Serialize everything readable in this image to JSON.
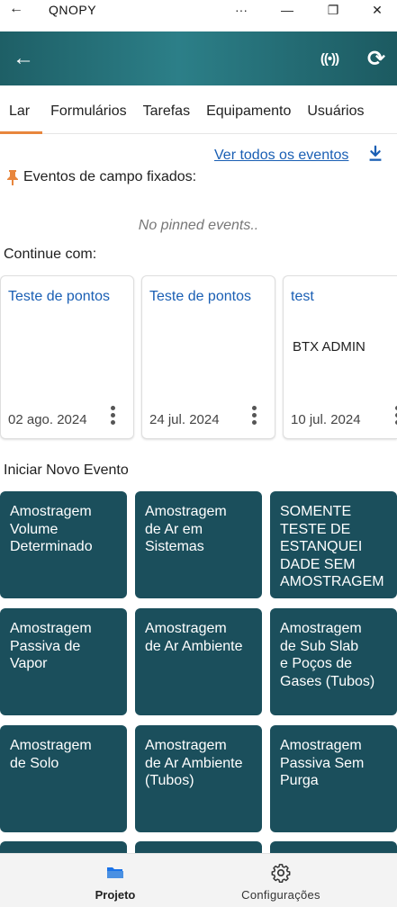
{
  "window": {
    "title": "QNOPY",
    "back_glyph": "←",
    "more_glyph": "···",
    "minimize_glyph": "—",
    "restore_glyph": "❐",
    "close_glyph": "✕"
  },
  "appbar": {
    "icons": [
      "arrow-left-icon",
      "broadcast-icon",
      "refresh-icon"
    ],
    "back_glyph": "←",
    "signal_glyph": "((•))",
    "refresh_glyph": "⟳"
  },
  "tabs": [
    {
      "label": "Lar",
      "active": true
    },
    {
      "label": "Formulários",
      "active": false
    },
    {
      "label": "Tarefas",
      "active": false
    },
    {
      "label": "Equipamento",
      "active": false
    },
    {
      "label": "Usuários",
      "active": false
    }
  ],
  "events": {
    "view_all_label": "Ver todos os eventos",
    "pinned_title": "Eventos de campo fixados:",
    "no_pinned": "No pinned events.."
  },
  "continue": {
    "title": "Continue com:",
    "cards": [
      {
        "title": "Teste de pontos",
        "user": "",
        "date": "02 ago. 2024"
      },
      {
        "title": "Teste de pontos",
        "user": "",
        "date": "24 jul. 2024"
      },
      {
        "title": "test",
        "user": "BTX ADMIN",
        "date": "10 jul. 2024"
      }
    ]
  },
  "new_event": {
    "title": "Iniciar Novo Evento",
    "tiles": [
      [
        "Amostragem",
        "Volume",
        "Determinado"
      ],
      [
        "Amostragem",
        "de Ar em",
        "Sistemas"
      ],
      [
        "SOMENTE",
        "TESTE DE",
        "ESTANQUEI",
        "DADE SEM",
        "AMOSTRAGEM"
      ],
      [
        "Amostragem",
        "Passiva de",
        "Vapor"
      ],
      [
        "Amostragem",
        "de Ar Ambiente"
      ],
      [
        "Amostragem",
        "de Sub Slab",
        "e Poços de",
        "Gases (Tubos)"
      ],
      [
        "Amostragem",
        "de Solo"
      ],
      [
        "Amostragem",
        "de Ar Ambiente",
        "(Tubos)"
      ],
      [
        "Amostragem",
        "Passiva Sem",
        "Purga"
      ],
      [],
      [],
      []
    ]
  },
  "bottom_nav": [
    {
      "label": "Projeto",
      "icon": "folder-icon",
      "active": true
    },
    {
      "label": "Configurações",
      "icon": "gear-icon",
      "active": false
    }
  ],
  "colors": {
    "appbar": "#1e5f66",
    "tile": "#1b4f5c",
    "accent": "#e8863d",
    "link": "#1a5fb4"
  }
}
